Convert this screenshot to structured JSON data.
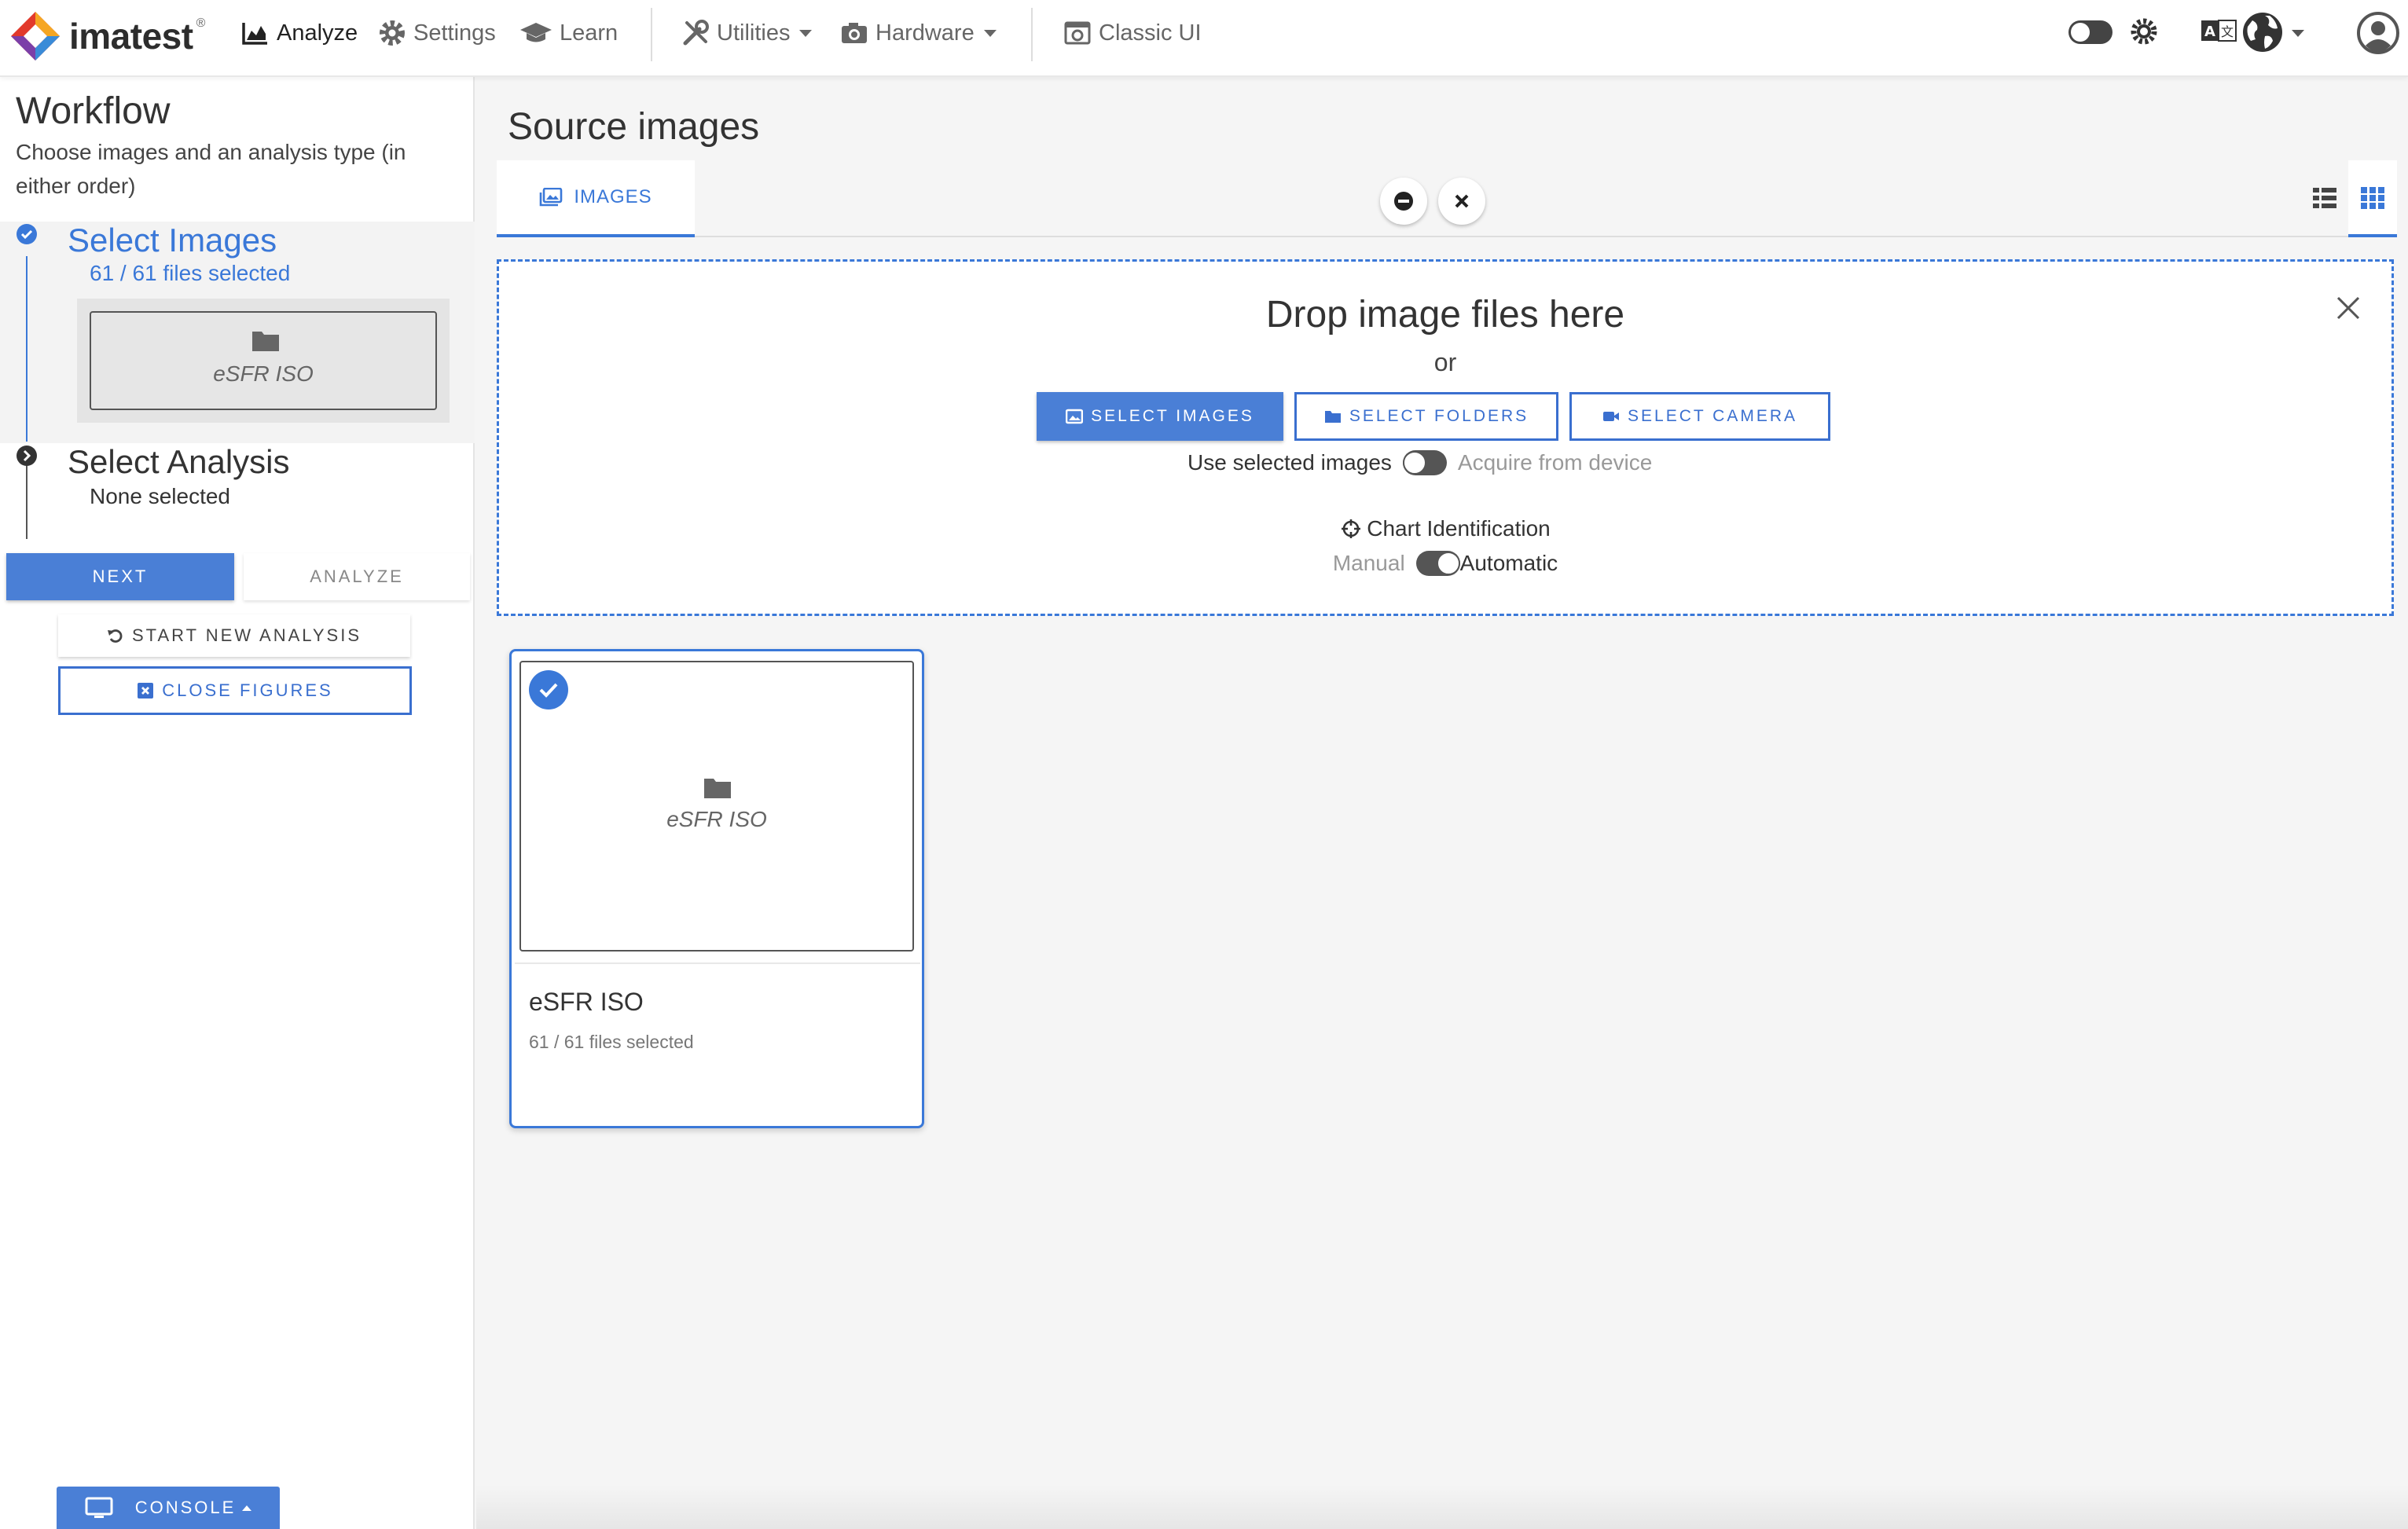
{
  "app": {
    "brand": "imatest",
    "reg_mark": "®"
  },
  "nav": {
    "analyze": "Analyze",
    "settings": "Settings",
    "learn": "Learn",
    "utilities": "Utilities",
    "hardware": "Hardware",
    "classic_ui": "Classic UI"
  },
  "sidebar": {
    "title": "Workflow",
    "subtitle": "Choose images and an analysis type (in either order)",
    "step1": {
      "title": "Select Images",
      "sub": "61 / 61 files selected",
      "thumb_label": "eSFR ISO"
    },
    "step2": {
      "title": "Select Analysis",
      "sub": "None selected"
    },
    "next_label": "NEXT",
    "analyze_label": "ANALYZE",
    "start_new_label": "START NEW ANALYSIS",
    "close_figures_label": "CLOSE FIGURES",
    "console_label": "CONSOLE"
  },
  "main": {
    "title": "Source images",
    "tab_images": "IMAGES",
    "dropzone": {
      "title": "Drop image files here",
      "or": "or",
      "select_images": "SELECT IMAGES",
      "select_folders": "SELECT FOLDERS",
      "select_camera": "SELECT CAMERA",
      "use_selected": "Use selected images",
      "acquire": "Acquire from device",
      "chart_id": "Chart Identification",
      "manual": "Manual",
      "automatic": "Automatic"
    },
    "card": {
      "thumb_label": "eSFR ISO",
      "title": "eSFR ISO",
      "sub": "61 / 61 files selected"
    }
  },
  "colors": {
    "accent": "#3a78d8",
    "button_primary": "#4a7fd6"
  }
}
